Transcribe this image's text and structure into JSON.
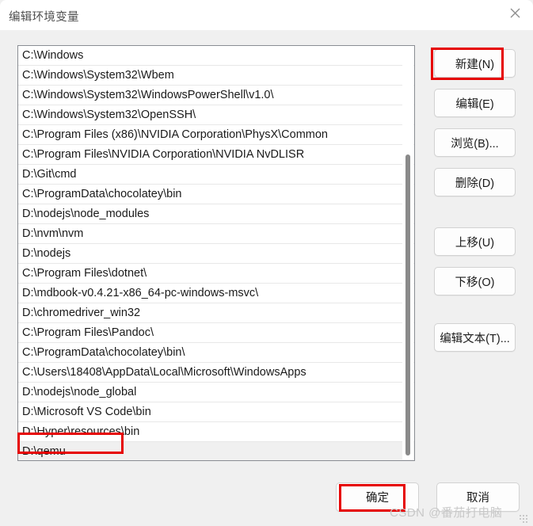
{
  "window": {
    "title": "编辑环境变量",
    "close_label": "✕"
  },
  "list": {
    "selected_index": 20,
    "items": [
      "C:\\Windows",
      "C:\\Windows\\System32\\Wbem",
      "C:\\Windows\\System32\\WindowsPowerShell\\v1.0\\",
      "C:\\Windows\\System32\\OpenSSH\\",
      "C:\\Program Files (x86)\\NVIDIA Corporation\\PhysX\\Common",
      "C:\\Program Files\\NVIDIA Corporation\\NVIDIA NvDLISR",
      "D:\\Git\\cmd",
      "C:\\ProgramData\\chocolatey\\bin",
      "D:\\nodejs\\node_modules",
      "D:\\nvm\\nvm",
      "D:\\nodejs",
      "C:\\Program Files\\dotnet\\",
      "D:\\mdbook-v0.4.21-x86_64-pc-windows-msvc\\",
      "D:\\chromedriver_win32",
      "C:\\Program Files\\Pandoc\\",
      "C:\\ProgramData\\chocolatey\\bin\\",
      "C:\\Users\\18408\\AppData\\Local\\Microsoft\\WindowsApps",
      "D:\\nodejs\\node_global",
      "D:\\Microsoft VS Code\\bin",
      "D:\\Hyper\\resources\\bin",
      "D:\\qemu"
    ]
  },
  "side_buttons": {
    "new": "新建(N)",
    "edit": "编辑(E)",
    "browse": "浏览(B)...",
    "delete": "删除(D)",
    "move_up": "上移(U)",
    "move_down": "下移(O)",
    "edit_text": "编辑文本(T)..."
  },
  "footer": {
    "ok": "确定",
    "cancel": "取消"
  },
  "watermark": {
    "text": "CSDN @番茄打电脑"
  },
  "colors": {
    "dialog_background": "#f0f0f0",
    "titlebar_background": "#ffffff",
    "list_background": "#ffffff",
    "list_border": "#8a8d93",
    "row_separator": "#e8e8e8",
    "row_selected": "#f0f0f0",
    "button_face": "#fdfdfd",
    "button_border": "#d2d2d2",
    "annotation_red": "#e60000",
    "scrollbar_thumb": "#8a8a8a",
    "watermark_gray": "#c8c8c8",
    "text_primary": "#1a1a1a",
    "title_text": "#4f4f4f"
  }
}
